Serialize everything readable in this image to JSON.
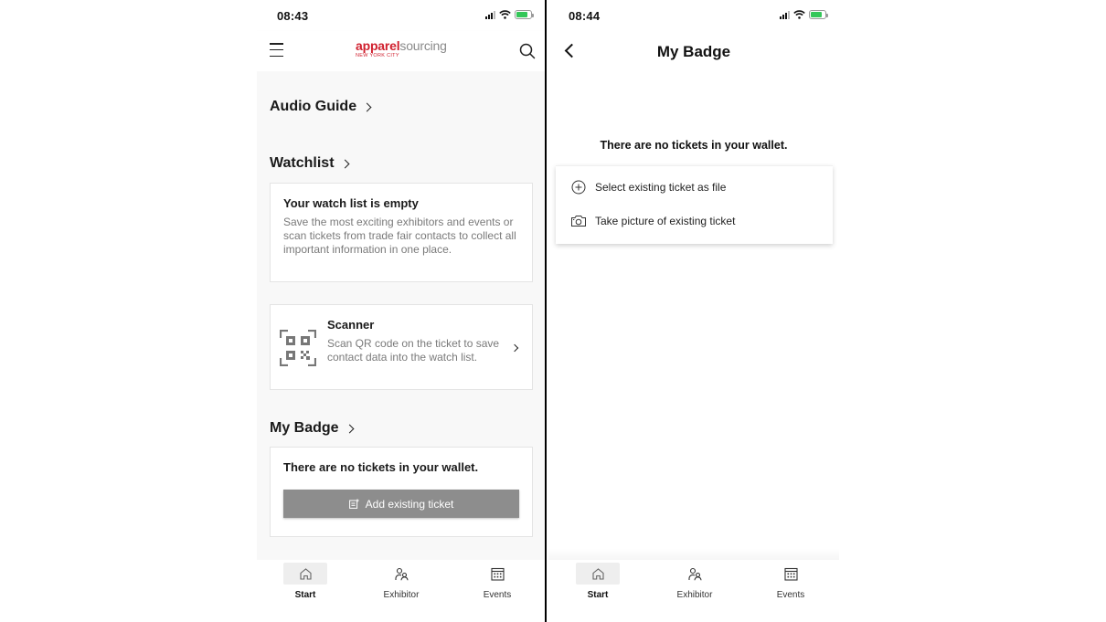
{
  "left": {
    "status": {
      "time": "08:43"
    },
    "header": {
      "logo_part1": "apparel",
      "logo_part2": "sourcing",
      "logo_sub": "NEW YORK CITY"
    },
    "audio_guide": {
      "title": "Audio Guide"
    },
    "watchlist": {
      "title": "Watchlist",
      "empty_title": "Your watch list is empty",
      "empty_text": "Save the most exciting exhibitors and events or scan tickets from trade fair contacts to collect all important information in one place."
    },
    "scanner": {
      "title": "Scanner",
      "text": "Scan QR code on the ticket to save contact data into the watch list."
    },
    "my_badge": {
      "title": "My Badge",
      "empty_text": "There are no tickets in your wallet.",
      "button_label": "Add existing ticket"
    },
    "tabs": [
      {
        "label": "Start",
        "icon": "home-icon",
        "active": true
      },
      {
        "label": "Exhibitor",
        "icon": "people-icon",
        "active": false
      },
      {
        "label": "Events",
        "icon": "calendar-icon",
        "active": false
      }
    ]
  },
  "right": {
    "status": {
      "time": "08:44"
    },
    "header": {
      "title": "My Badge"
    },
    "empty_text": "There are no tickets in your wallet.",
    "menu": [
      {
        "label": "Select existing ticket as file",
        "icon": "plus-circle-icon"
      },
      {
        "label": "Take picture of existing ticket",
        "icon": "camera-icon"
      }
    ],
    "tabs": [
      {
        "label": "Start",
        "icon": "home-icon",
        "active": true
      },
      {
        "label": "Exhibitor",
        "icon": "people-icon",
        "active": false
      },
      {
        "label": "Events",
        "icon": "calendar-icon",
        "active": false
      }
    ]
  },
  "colors": {
    "brand_red": "#d0202e",
    "button_gray": "#8d8d8d",
    "battery_green": "#34c759"
  }
}
